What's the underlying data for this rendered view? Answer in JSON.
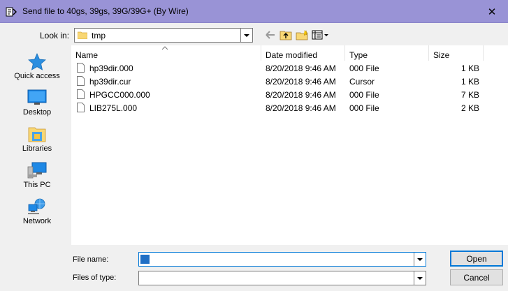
{
  "window": {
    "title": "Send file to 40gs, 39gs, 39G/39G+ (By Wire)",
    "close_glyph": "✕"
  },
  "lookin": {
    "label": "Look in:",
    "value": "tmp",
    "icon": "folder-icon"
  },
  "toolbar": {
    "back_icon": "back-arrow-icon",
    "up_icon": "up-folder-icon",
    "new_folder_icon": "new-folder-icon",
    "view_icon": "view-menu-icon"
  },
  "places": [
    {
      "label": "Quick access",
      "icon": "star-icon"
    },
    {
      "label": "Desktop",
      "icon": "desktop-icon"
    },
    {
      "label": "Libraries",
      "icon": "libraries-icon"
    },
    {
      "label": "This PC",
      "icon": "computer-icon"
    },
    {
      "label": "Network",
      "icon": "network-icon"
    }
  ],
  "columns": {
    "name": "Name",
    "date": "Date modified",
    "type": "Type",
    "size": "Size"
  },
  "files": [
    {
      "name": "hp39dir.000",
      "date": "8/20/2018 9:46 AM",
      "type": "000 File",
      "size": "1 KB"
    },
    {
      "name": "hp39dir.cur",
      "date": "8/20/2018 9:46 AM",
      "type": "Cursor",
      "size": "1 KB"
    },
    {
      "name": "HPGCC000.000",
      "date": "8/20/2018 9:46 AM",
      "type": "000 File",
      "size": "7 KB"
    },
    {
      "name": "LIB275L.000",
      "date": "8/20/2018 9:46 AM",
      "type": "000 File",
      "size": "2 KB"
    }
  ],
  "filename": {
    "label": "File name:",
    "value": ""
  },
  "filetype": {
    "label": "Files of type:",
    "value": ""
  },
  "buttons": {
    "open": "Open",
    "cancel": "Cancel"
  },
  "colors": {
    "titlebar": "#9993d6",
    "dialog_bg": "#f0f0f0",
    "accent": "#0078d7"
  }
}
